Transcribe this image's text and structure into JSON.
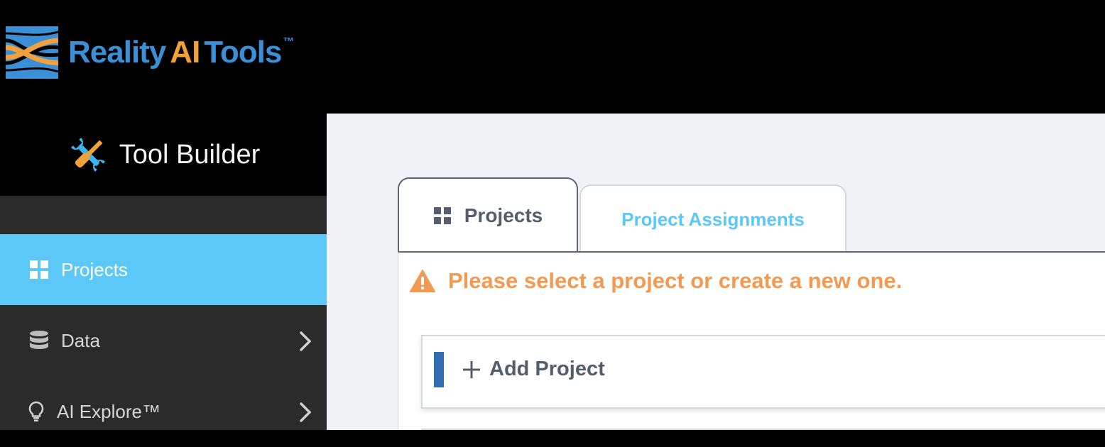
{
  "brand": {
    "reality": "Reality",
    "ai": "AI",
    "tools": "Tools",
    "tm": "™",
    "colors": {
      "blue": "#3b8fd6",
      "orange": "#f2a13a"
    }
  },
  "app_header": {
    "icon": "tools-icon",
    "title": "Tool Builder"
  },
  "sidebar": {
    "items": [
      {
        "label": "Projects",
        "icon": "grid-icon",
        "active": true,
        "has_chevron": false
      },
      {
        "label": "Data",
        "icon": "database-icon",
        "active": false,
        "has_chevron": true
      },
      {
        "label": "AI Explore™",
        "icon": "lightbulb-icon",
        "active": false,
        "has_chevron": true
      }
    ],
    "active_color": "#5bc8f7"
  },
  "tabs": [
    {
      "label": "Projects",
      "icon": "grid-icon",
      "active": true
    },
    {
      "label": "Project Assignments",
      "active": false
    }
  ],
  "warning": {
    "icon": "warning-icon",
    "text": "Please select a project or create a new one.",
    "color": "#f29a52"
  },
  "add_project": {
    "icon": "plus-icon",
    "label": "Add Project",
    "accent_color": "#2f6db3"
  }
}
